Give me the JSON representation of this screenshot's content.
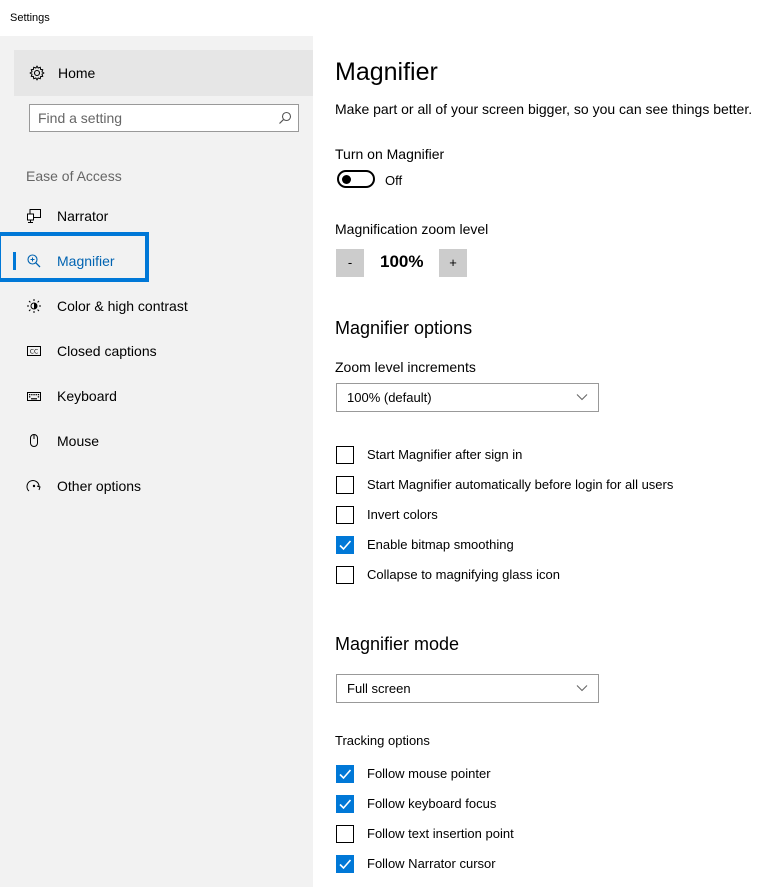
{
  "window": {
    "title": "Settings"
  },
  "sidebar": {
    "home_label": "Home",
    "search_placeholder": "Find a setting",
    "section_label": "Ease of Access",
    "items": [
      {
        "label": "Narrator",
        "icon": "narrator-icon"
      },
      {
        "label": "Magnifier",
        "icon": "magnifier-icon",
        "selected": true
      },
      {
        "label": "Color & high contrast",
        "icon": "brightness-icon"
      },
      {
        "label": "Closed captions",
        "icon": "closed-captions-icon"
      },
      {
        "label": "Keyboard",
        "icon": "keyboard-icon"
      },
      {
        "label": "Mouse",
        "icon": "mouse-icon"
      },
      {
        "label": "Other options",
        "icon": "other-options-icon"
      }
    ]
  },
  "main": {
    "title": "Magnifier",
    "description": "Make part or all of your screen bigger, so you can see things better.",
    "turn_on": {
      "label": "Turn on Magnifier",
      "state": "Off"
    },
    "zoom": {
      "label": "Magnification zoom level",
      "minus": "-",
      "value": "100%",
      "plus": "+"
    },
    "options": {
      "heading": "Magnifier options",
      "increments_label": "Zoom level increments",
      "increments_value": "100% (default)",
      "checkboxes": [
        {
          "label": "Start Magnifier after sign in",
          "checked": false
        },
        {
          "label": "Start Magnifier automatically before login for all users",
          "checked": false
        },
        {
          "label": "Invert colors",
          "checked": false
        },
        {
          "label": "Enable bitmap smoothing",
          "checked": true
        },
        {
          "label": "Collapse to magnifying glass icon",
          "checked": false
        }
      ]
    },
    "mode": {
      "heading": "Magnifier mode",
      "value": "Full screen",
      "tracking_label": "Tracking options",
      "checkboxes": [
        {
          "label": "Follow mouse pointer",
          "checked": true
        },
        {
          "label": "Follow keyboard focus",
          "checked": true
        },
        {
          "label": "Follow text insertion point",
          "checked": false
        },
        {
          "label": "Follow Narrator cursor",
          "checked": true
        }
      ]
    }
  },
  "colors": {
    "accent": "#0078d7",
    "selected_text": "#0063b1",
    "sidebar_bg": "#f2f2f2"
  }
}
